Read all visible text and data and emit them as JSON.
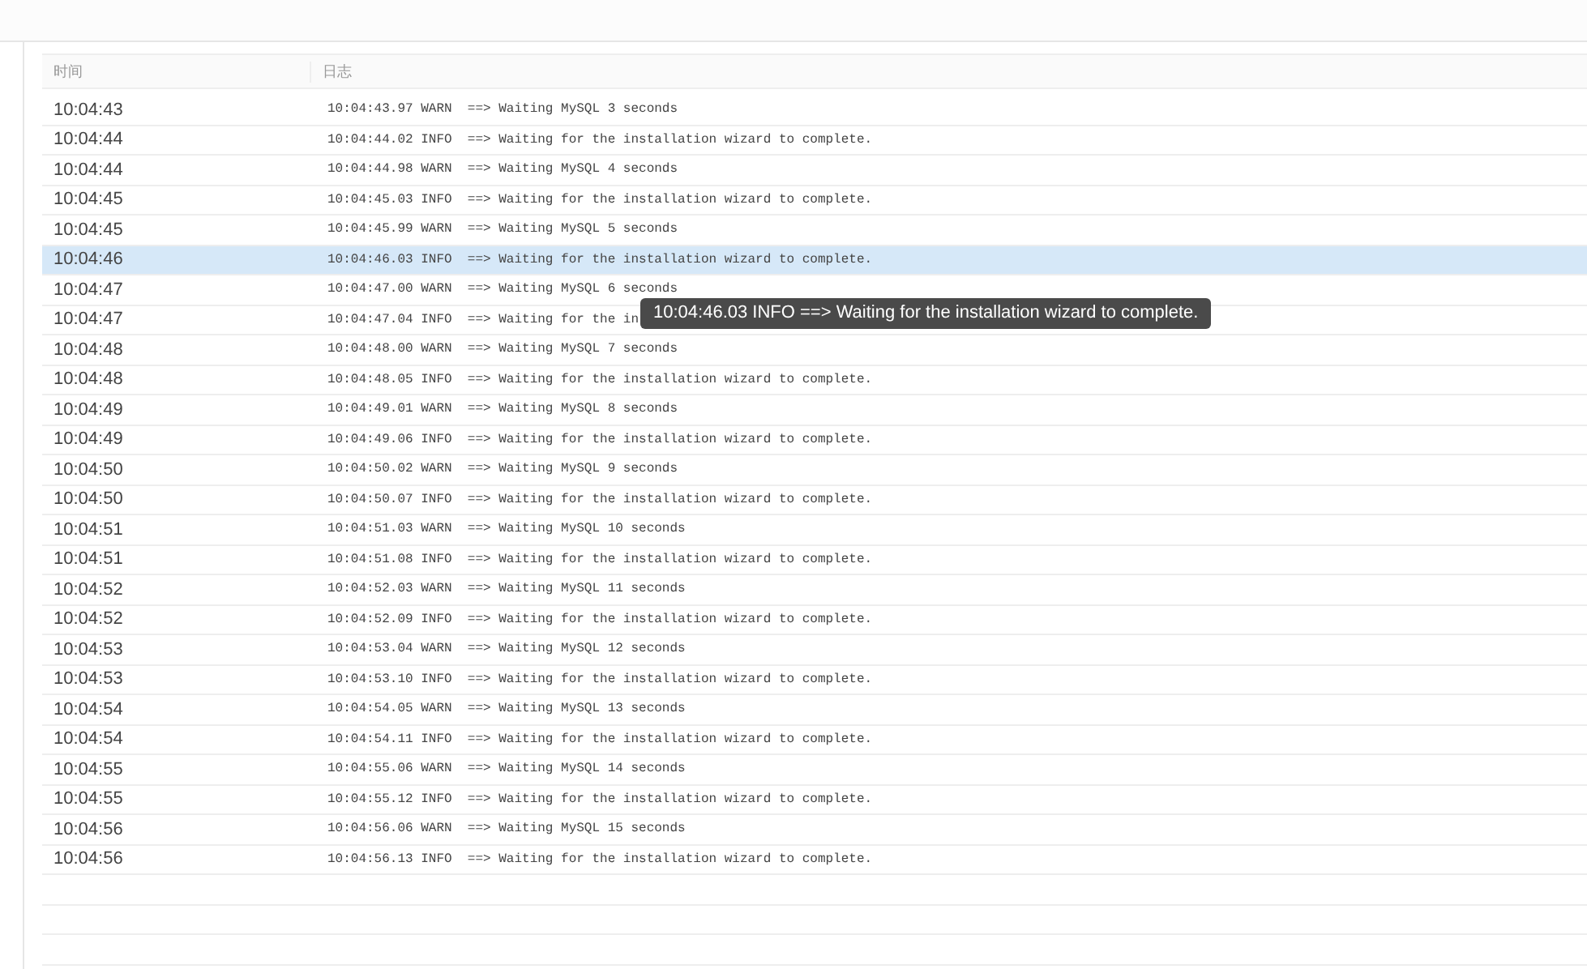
{
  "table": {
    "columns": [
      "时间",
      "日志"
    ],
    "rows": [
      {
        "time": "10:04:43",
        "log": "10:04:43.97 WARN  ==> Waiting MySQL 3 seconds",
        "hovered": false
      },
      {
        "time": "10:04:44",
        "log": "10:04:44.02 INFO  ==> Waiting for the installation wizard to complete.",
        "hovered": false
      },
      {
        "time": "10:04:44",
        "log": "10:04:44.98 WARN  ==> Waiting MySQL 4 seconds",
        "hovered": false
      },
      {
        "time": "10:04:45",
        "log": "10:04:45.03 INFO  ==> Waiting for the installation wizard to complete.",
        "hovered": false
      },
      {
        "time": "10:04:45",
        "log": "10:04:45.99 WARN  ==> Waiting MySQL 5 seconds",
        "hovered": false
      },
      {
        "time": "10:04:46",
        "log": "10:04:46.03 INFO  ==> Waiting for the installation wizard to complete.",
        "hovered": true
      },
      {
        "time": "10:04:47",
        "log": "10:04:47.00 WARN  ==> Waiting MySQL 6 seconds",
        "hovered": false
      },
      {
        "time": "10:04:47",
        "log": "10:04:47.04 INFO  ==> Waiting for the in",
        "hovered": false
      },
      {
        "time": "10:04:48",
        "log": "10:04:48.00 WARN  ==> Waiting MySQL 7 seconds",
        "hovered": false
      },
      {
        "time": "10:04:48",
        "log": "10:04:48.05 INFO  ==> Waiting for the installation wizard to complete.",
        "hovered": false
      },
      {
        "time": "10:04:49",
        "log": "10:04:49.01 WARN  ==> Waiting MySQL 8 seconds",
        "hovered": false
      },
      {
        "time": "10:04:49",
        "log": "10:04:49.06 INFO  ==> Waiting for the installation wizard to complete.",
        "hovered": false
      },
      {
        "time": "10:04:50",
        "log": "10:04:50.02 WARN  ==> Waiting MySQL 9 seconds",
        "hovered": false
      },
      {
        "time": "10:04:50",
        "log": "10:04:50.07 INFO  ==> Waiting for the installation wizard to complete.",
        "hovered": false
      },
      {
        "time": "10:04:51",
        "log": "10:04:51.03 WARN  ==> Waiting MySQL 10 seconds",
        "hovered": false
      },
      {
        "time": "10:04:51",
        "log": "10:04:51.08 INFO  ==> Waiting for the installation wizard to complete.",
        "hovered": false
      },
      {
        "time": "10:04:52",
        "log": "10:04:52.03 WARN  ==> Waiting MySQL 11 seconds",
        "hovered": false
      },
      {
        "time": "10:04:52",
        "log": "10:04:52.09 INFO  ==> Waiting for the installation wizard to complete.",
        "hovered": false
      },
      {
        "time": "10:04:53",
        "log": "10:04:53.04 WARN  ==> Waiting MySQL 12 seconds",
        "hovered": false
      },
      {
        "time": "10:04:53",
        "log": "10:04:53.10 INFO  ==> Waiting for the installation wizard to complete.",
        "hovered": false
      },
      {
        "time": "10:04:54",
        "log": "10:04:54.05 WARN  ==> Waiting MySQL 13 seconds",
        "hovered": false
      },
      {
        "time": "10:04:54",
        "log": "10:04:54.11 INFO  ==> Waiting for the installation wizard to complete.",
        "hovered": false
      },
      {
        "time": "10:04:55",
        "log": "10:04:55.06 WARN  ==> Waiting MySQL 14 seconds",
        "hovered": false
      },
      {
        "time": "10:04:55",
        "log": "10:04:55.12 INFO  ==> Waiting for the installation wizard to complete.",
        "hovered": false
      },
      {
        "time": "10:04:56",
        "log": "10:04:56.06 WARN  ==> Waiting MySQL 15 seconds",
        "hovered": false
      },
      {
        "time": "10:04:56",
        "log": "10:04:56.13 INFO  ==> Waiting for the installation wizard to complete.",
        "hovered": false
      }
    ]
  },
  "tooltip": {
    "text": "10:04:46.03 INFO ==> Waiting for the installation wizard to complete."
  }
}
